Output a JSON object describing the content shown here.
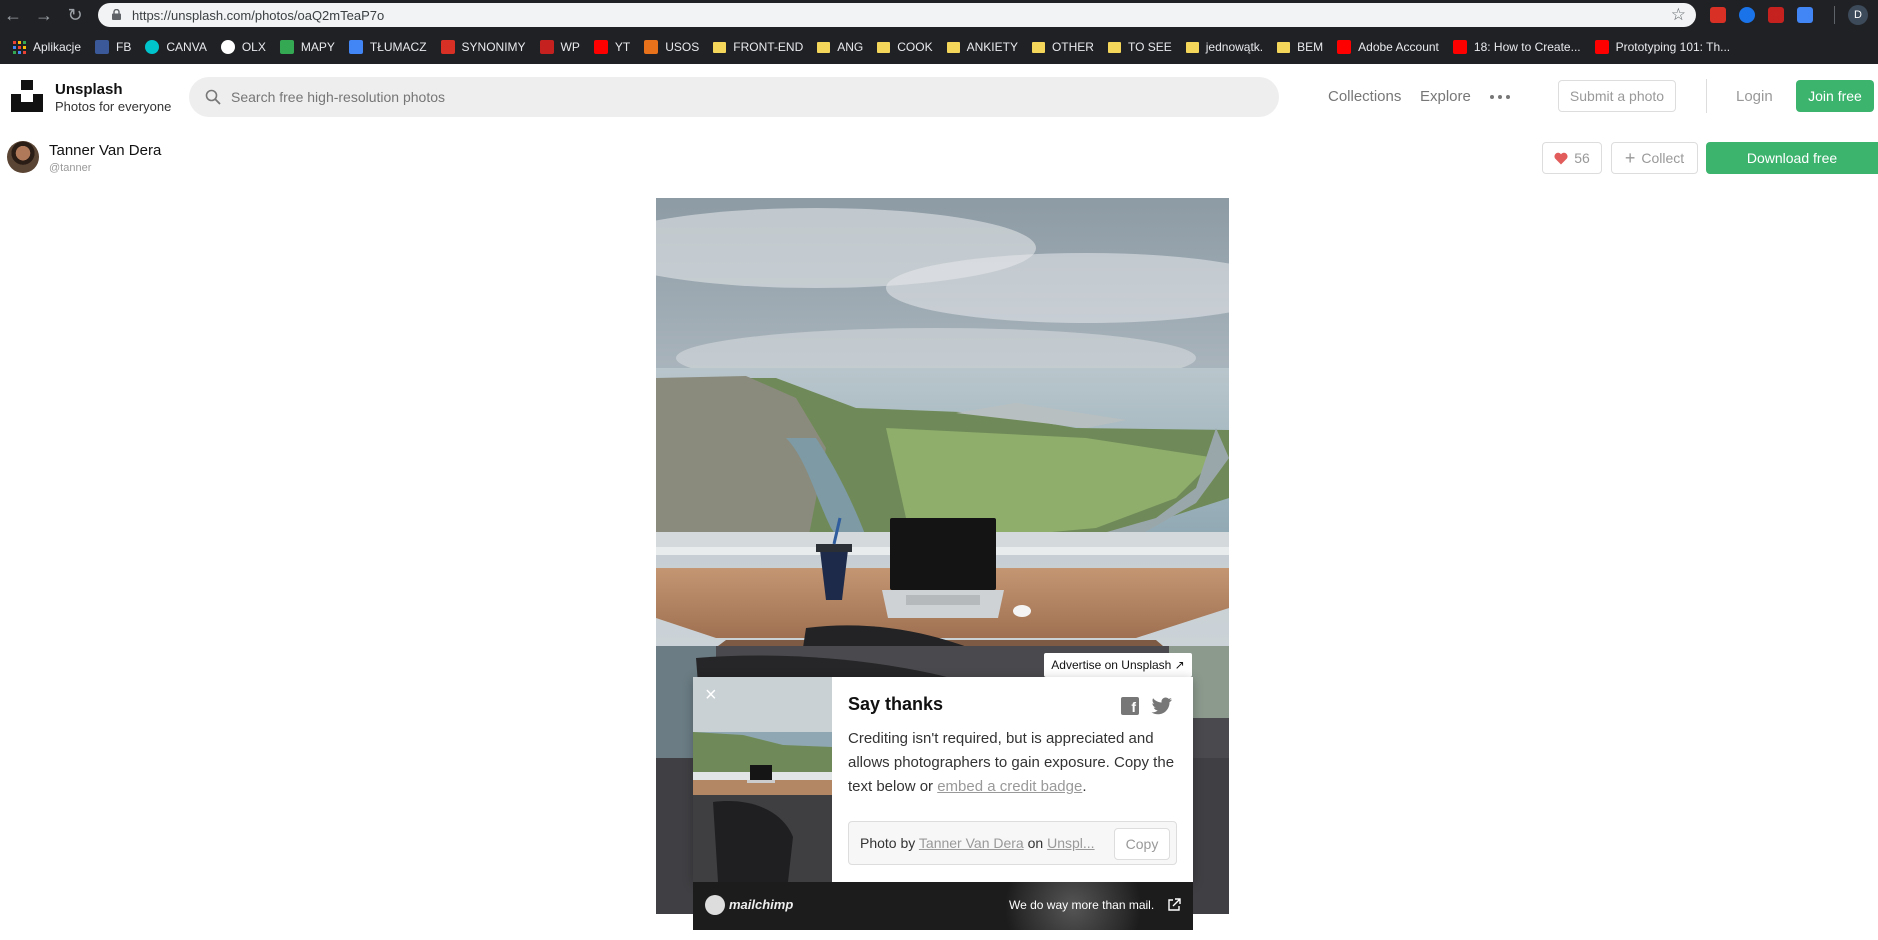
{
  "browser": {
    "url": "https://unsplash.com/photos/oaQ2mTeaP7o",
    "bookmarks": [
      {
        "label": "Aplikacje",
        "icon": "apps-grid-icon"
      },
      {
        "label": "FB",
        "icon": "facebook-icon"
      },
      {
        "label": "CANVA",
        "icon": "canva-icon"
      },
      {
        "label": "OLX",
        "icon": "olx-icon"
      },
      {
        "label": "MAPY",
        "icon": "maps-icon"
      },
      {
        "label": "TŁUMACZ",
        "icon": "translate-icon"
      },
      {
        "label": "SYNONIMY",
        "icon": "synonimy-icon"
      },
      {
        "label": "WP",
        "icon": "wp-icon"
      },
      {
        "label": "YT",
        "icon": "youtube-icon"
      },
      {
        "label": "USOS",
        "icon": "usos-icon"
      },
      {
        "label": "FRONT-END",
        "icon": "folder-icon"
      },
      {
        "label": "ANG",
        "icon": "folder-icon"
      },
      {
        "label": "COOK",
        "icon": "folder-icon"
      },
      {
        "label": "ANKIETY",
        "icon": "folder-icon"
      },
      {
        "label": "OTHER",
        "icon": "folder-icon"
      },
      {
        "label": "TO SEE",
        "icon": "folder-icon"
      },
      {
        "label": "jednowątk.",
        "icon": "folder-icon"
      },
      {
        "label": "BEM",
        "icon": "folder-icon"
      },
      {
        "label": "Adobe Account",
        "icon": "adobe-icon"
      },
      {
        "label": "18: How to Create...",
        "icon": "youtube-icon"
      },
      {
        "label": "Prototyping 101: Th...",
        "icon": "adobe-icon"
      }
    ],
    "profile_initial": "D",
    "extension_badge": "4"
  },
  "header": {
    "brand_name": "Unsplash",
    "brand_tagline": "Photos for everyone",
    "search_placeholder": "Search free high-resolution photos",
    "nav": {
      "collections": "Collections",
      "explore": "Explore"
    },
    "submit_label": "Submit a photo",
    "login_label": "Login",
    "join_label": "Join free"
  },
  "photo": {
    "author_name": "Tanner Van Dera",
    "author_handle": "@tanner",
    "likes": "56",
    "collect_label": "Collect",
    "download_label": "Download free"
  },
  "modal": {
    "ad_label": "Advertise on Unsplash ↗",
    "close": "×",
    "title": "Say thanks",
    "body_text": "Crediting isn't required, but is appreciated and allows photographers to gain exposure. Copy the text below or ",
    "body_link": "embed a credit badge",
    "body_end": ".",
    "credit_prefix": "Photo by ",
    "credit_author": "Tanner Van Dera",
    "credit_middle": " on ",
    "credit_site": "Unspl...",
    "copy_label": "Copy"
  },
  "sponsor": {
    "name": "mailchimp",
    "tagline": "We do way more than mail."
  },
  "colors": {
    "accent_green": "#3cb46e",
    "heart_red": "#e25c5c",
    "chrome_dark": "#202124"
  }
}
